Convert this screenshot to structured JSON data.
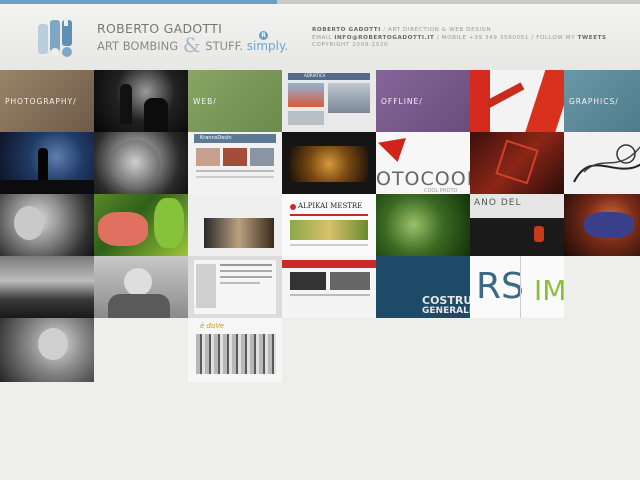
{
  "site": {
    "name": "ROBERTO GADOTTI",
    "tagline_part1": "ART BOMBING",
    "tagline_amp": "&",
    "tagline_part2": "STUFF.",
    "tagline_simply": "simply.",
    "badge": "R"
  },
  "contact": {
    "line1": {
      "name": "ROBERTO GADOTTI",
      "sep": " / ",
      "role": "ART DIRECTION & WEB DESIGN"
    },
    "line2": {
      "email_label": "EMAIL ",
      "email": "INFO@ROBERTOGADOTTI.IT",
      "mobile": " / MOBILE  +39 349 3590051 / FOLLOW MY ",
      "tweets": "TWEETS"
    },
    "line3": "COPYRIGHT 2009-2020"
  },
  "categories": {
    "photography": "PHOTOGRAPHY/",
    "web": "WEB/",
    "offline": "OFFLINE/",
    "graphics": "GRAPHICS/"
  },
  "thumb_text": {
    "web_header": "KrannsDesIn",
    "site_title": "ALPIKAI MESTRE",
    "photocool": "OTOCOOL",
    "photocool_sub": "COOL PHOTO",
    "costruz": "COSTRUZ",
    "generale": "GENERALE",
    "logo_im": "IM",
    "logo_rs": "RS",
    "road": "ANO DEL",
    "menu_sign": "è duVe",
    "adr": "ADRIATICA"
  },
  "colors": {
    "accent": "#6a9fc6",
    "photography_tile": "#8a7560",
    "web_tile": "#7a9a58",
    "offline_tile": "#7b5a8c",
    "graphics_tile": "#5c8a98",
    "background": "#eeeeea"
  }
}
